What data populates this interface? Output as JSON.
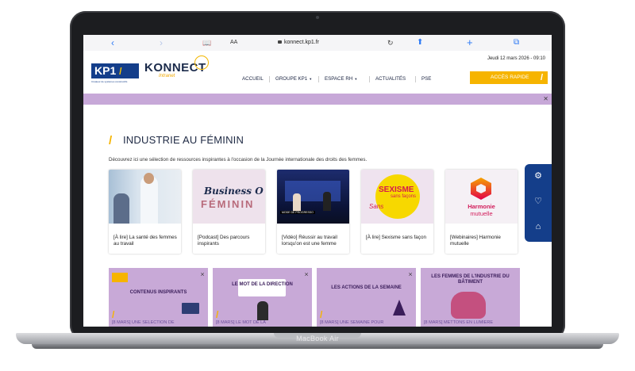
{
  "device": {
    "label": "MacBook Air"
  },
  "browser": {
    "back": "‹",
    "forward": "›",
    "aa": "AA",
    "url": "konnect.kp1.fr",
    "reload": "↻"
  },
  "header": {
    "kp1_logo": "KP1",
    "kp1_tagline": "Créateur de systèmes constructifs",
    "konnect_logo": "KONNECT",
    "konnect_sub": "Intranet",
    "date": "Jeudi 12 mars 2026 - 09:10",
    "nav": [
      "ACCUEIL",
      "GROUPE KP1",
      "ESPACE RH",
      "ACTUALITÉS",
      "PSE"
    ],
    "acces": "ACCÈS RAPIDE"
  },
  "page": {
    "title": "INDUSTRIE AU FÉMININ",
    "intro": "Découvrez ici une sélection de ressources inspirantes à l'occasion de la Journée internationale des droits des femmes."
  },
  "cards": [
    {
      "label": "[À lire] La santé des femmes au travail",
      "icon": "doctor-photo"
    },
    {
      "label": "[Podcast] Des parcours inspirants",
      "icon": "business-o-feminin-image",
      "img_t1": "Business O",
      "img_t2": "FÉMININ"
    },
    {
      "label": "[Vidéo] Réussir au travail lorsqu'on est une femme",
      "icon": "tv-studio-photo",
      "img_tag": "MODE DE PROGRESSO"
    },
    {
      "label": "[À lire] Sexisme sans façon",
      "icon": "sexisme-image",
      "img_t1": "SEXISME",
      "img_t2": "sans façons",
      "img_t3": "Sans"
    },
    {
      "label": "[Webinaires] Harmonie mutuelle",
      "icon": "harmonie-logo",
      "img_t1": "Harmonie",
      "img_t2": "mutuelle"
    }
  ],
  "bottom_cards": [
    {
      "title": "CONTENUS INSPIRANTS",
      "caption": "[8 MARS] UNE SÉLECTION DE"
    },
    {
      "title": "LE MOT DE LA DIRECTION",
      "caption": "[8 MARS] LE MOT DE LA"
    },
    {
      "title": "LES ACTIONS DE LA SEMAINE",
      "caption": "[8 MARS] UNE SEMAINE POUR"
    },
    {
      "title": "LES FEMMES DE L'INDUSTRIE DU BÂTIMENT",
      "caption": "[8 MARS] METTONS EN LUMIÈRE"
    }
  ],
  "colors": {
    "brand_blue": "#143e8a",
    "accent_yellow": "#f6b400",
    "band_purple": "#c7a8d8"
  }
}
